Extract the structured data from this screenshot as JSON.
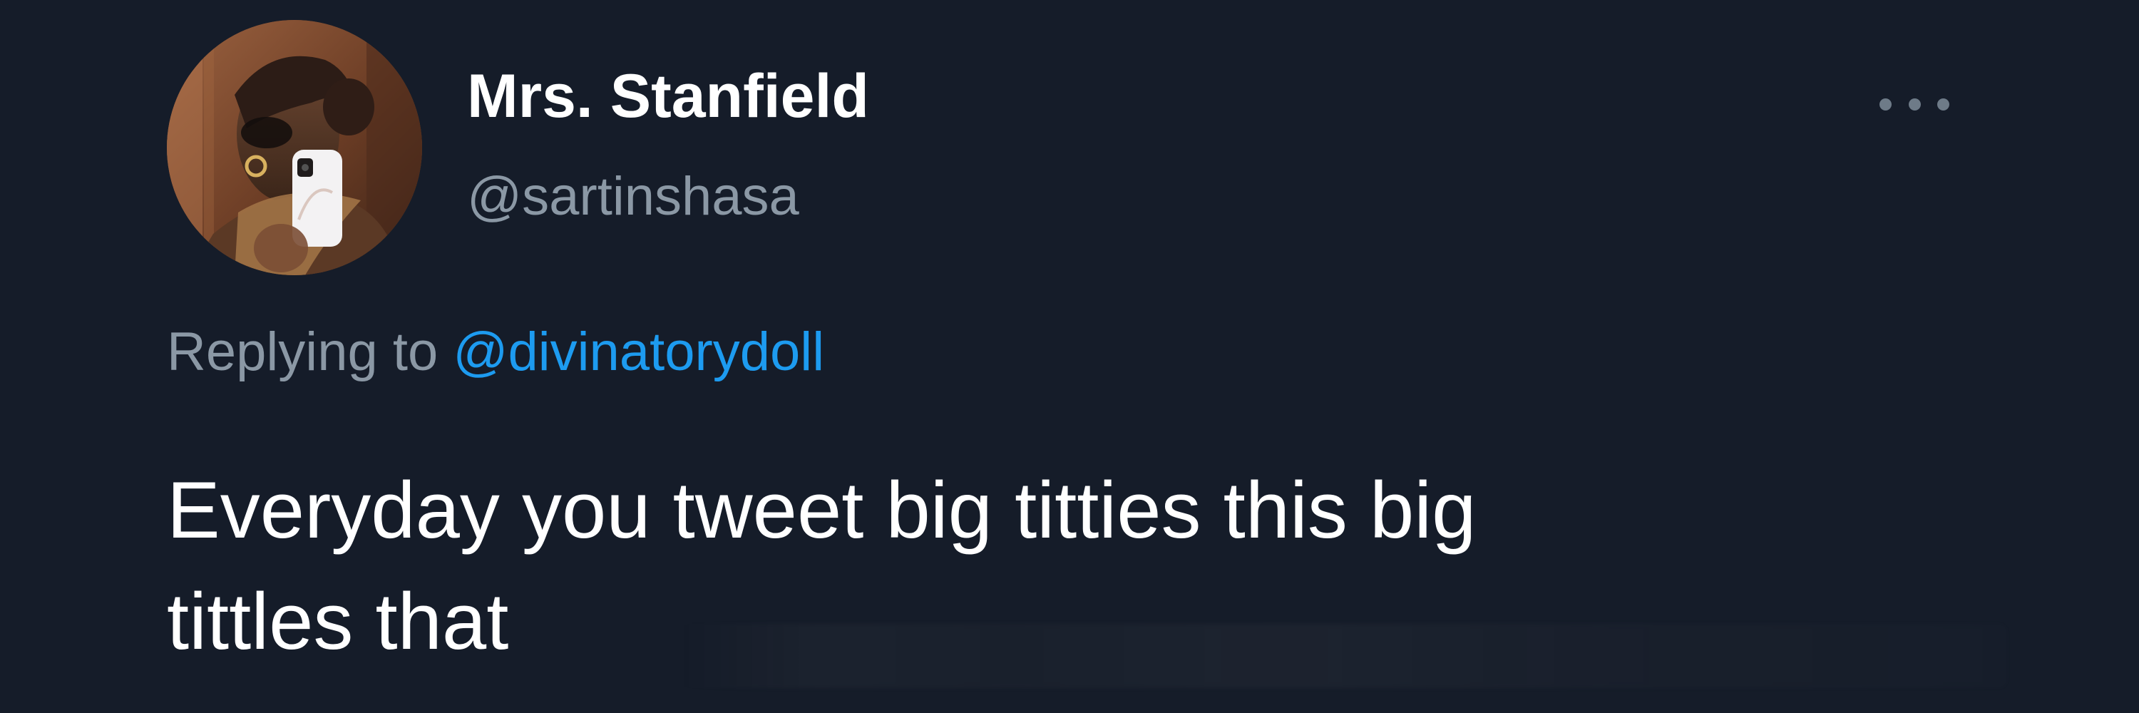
{
  "app": {
    "type": "tweet-reply",
    "theme": "dark"
  },
  "author": {
    "display_name": "Mrs. Stanfield",
    "handle": "@sartinshasa",
    "avatar_icon": "profile-photo-icon"
  },
  "reply": {
    "prefix": "Replying to",
    "target_handle": "@divinatorydoll"
  },
  "tweet": {
    "line_1": "Everyday you tweet big titties this big",
    "line_2": "tittles that"
  },
  "menu": {
    "icon": "more-options-icon"
  },
  "colors": {
    "background": "#151c29",
    "primary_text": "#ffffff",
    "secondary_text": "#8b98a5",
    "accent": "#1d9bf0"
  }
}
